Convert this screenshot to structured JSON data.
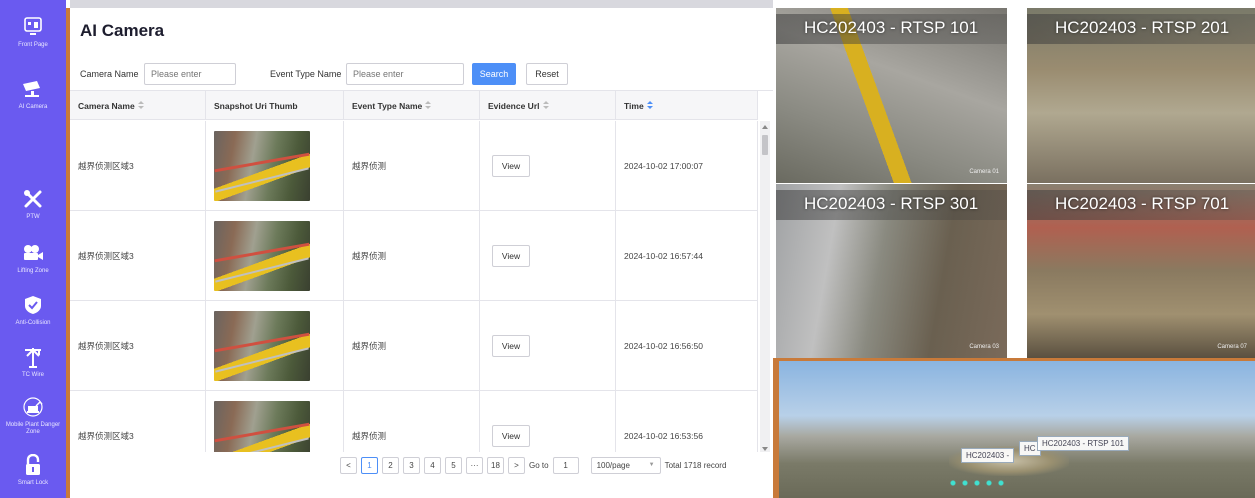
{
  "sidebar": {
    "items": [
      {
        "label": "Front Page",
        "icon": "dashboard-icon"
      },
      {
        "label": "AI Camera",
        "icon": "camera-icon"
      },
      {
        "label": "PTW",
        "icon": "tools-icon"
      },
      {
        "label": "Lifting Zone",
        "icon": "video-camera-icon"
      },
      {
        "label": "Anti-Collision",
        "icon": "shield-check-icon"
      },
      {
        "label": "TC Wire",
        "icon": "tower-crane-icon"
      },
      {
        "label": "Mobile Plant Danger Zone",
        "icon": "excavator-icon"
      },
      {
        "label": "Smart Lock",
        "icon": "lock-icon"
      }
    ]
  },
  "page": {
    "title": "AI Camera"
  },
  "filters": {
    "camera_name_label": "Camera Name",
    "camera_name_placeholder": "Please enter",
    "event_type_label": "Event Type Name",
    "event_type_placeholder": "Please enter",
    "search_label": "Search",
    "reset_label": "Reset"
  },
  "table": {
    "columns": [
      "Camera Name",
      "Snapshot Uri Thumb",
      "Event Type Name",
      "Evidence Url",
      "Time"
    ],
    "rows": [
      {
        "camera": "越界侦测区域3",
        "event": "越界侦测",
        "evidence": "View",
        "time": "2024-10-02 17:00:07"
      },
      {
        "camera": "越界侦测区域3",
        "event": "越界侦测",
        "evidence": "View",
        "time": "2024-10-02 16:57:44"
      },
      {
        "camera": "越界侦测区域3",
        "event": "越界侦测",
        "evidence": "View",
        "time": "2024-10-02 16:56:50"
      },
      {
        "camera": "越界侦测区域3",
        "event": "越界侦测",
        "evidence": "View",
        "time": "2024-10-02 16:53:56"
      }
    ]
  },
  "pagination": {
    "prev": "<",
    "pages": [
      "1",
      "2",
      "3",
      "4",
      "5",
      "···",
      "18"
    ],
    "next": ">",
    "goto_label": "Go to",
    "goto_value": "1",
    "page_size": "100/page",
    "total": "Total 1718 record"
  },
  "cameras": [
    {
      "title": "HC202403 - RTSP 101",
      "stamp": "Camera 01"
    },
    {
      "title": "HC202403 - RTSP 201",
      "stamp": ""
    },
    {
      "title": "HC202403 - RTSP 301",
      "stamp": "Camera 03"
    },
    {
      "title": "HC202403 - RTSP 701",
      "stamp": "Camera 07"
    }
  ],
  "map": {
    "labels": [
      "HC202403 -",
      "HC",
      "HC202403 - RTSP 101"
    ]
  },
  "colors": {
    "sidebar": "#6a5af0",
    "accent": "#c87a3a",
    "primary": "#4d8ff7"
  }
}
